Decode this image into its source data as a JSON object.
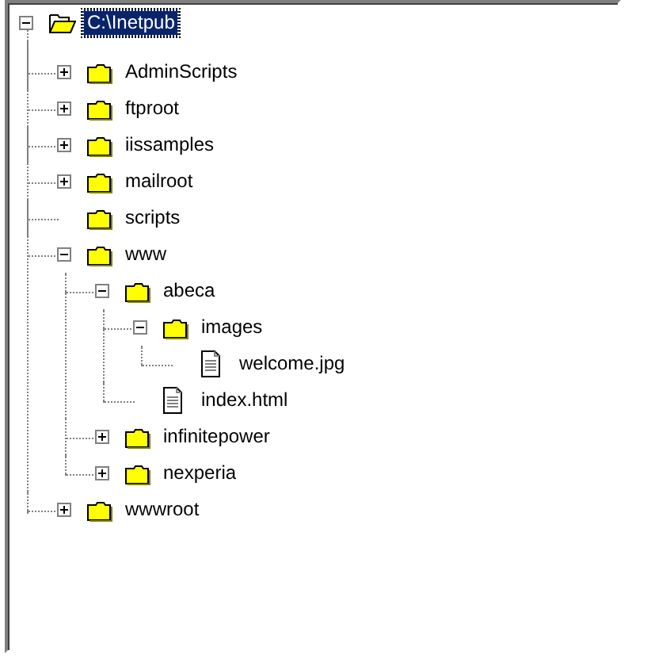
{
  "tree": [
    {
      "label": "C:\\Inetpub",
      "kind": "open-folder",
      "selected": true,
      "expanded": true,
      "children": [
        {
          "label": "AdminScripts",
          "kind": "folder",
          "selected": false,
          "expanded": false
        },
        {
          "label": "ftproot",
          "kind": "folder",
          "selected": false,
          "expanded": false
        },
        {
          "label": "iissamples",
          "kind": "folder",
          "selected": false,
          "expanded": false
        },
        {
          "label": "mailroot",
          "kind": "folder",
          "selected": false,
          "expanded": false
        },
        {
          "label": "scripts",
          "kind": "folder",
          "selected": false
        },
        {
          "label": "www",
          "kind": "folder",
          "selected": false,
          "expanded": true,
          "children": [
            {
              "label": "abeca",
              "kind": "folder",
              "selected": false,
              "expanded": true,
              "children": [
                {
                  "label": "images",
                  "kind": "folder",
                  "selected": false,
                  "expanded": true,
                  "children": [
                    {
                      "label": "welcome.jpg",
                      "kind": "file",
                      "selected": false
                    }
                  ]
                },
                {
                  "label": "index.html",
                  "kind": "file",
                  "selected": false
                }
              ]
            },
            {
              "label": "infinitepower",
              "kind": "folder",
              "selected": false,
              "expanded": false
            },
            {
              "label": "nexperia",
              "kind": "folder",
              "selected": false,
              "expanded": false
            }
          ]
        },
        {
          "label": "wwwroot",
          "kind": "folder",
          "selected": false,
          "expanded": false
        }
      ]
    }
  ]
}
